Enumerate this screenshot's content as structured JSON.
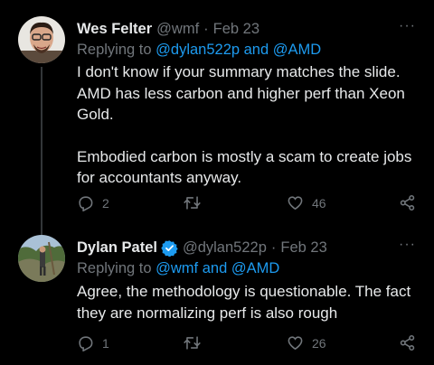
{
  "tweets": [
    {
      "name": "Wes Felter",
      "handle": "@wmf",
      "separator": "·",
      "date": "Feb 23",
      "replying_prefix": "Replying to ",
      "replying_mentions": "@dylan522p and @AMD",
      "paragraphs": [
        "I don't know if your summary matches the slide. AMD has less carbon and higher perf than Xeon Gold.",
        "Embodied carbon is mostly a scam to create jobs for accountants anyway."
      ],
      "replies": "2",
      "retweets": "",
      "likes": "46",
      "verified": false
    },
    {
      "name": "Dylan Patel",
      "handle": "@dylan522p",
      "separator": "·",
      "date": "Feb 23",
      "replying_prefix": "Replying to ",
      "replying_mentions": "@wmf and @AMD",
      "paragraphs": [
        "Agree, the methodology is questionable. The fact they are normalizing perf is also rough"
      ],
      "replies": "1",
      "retweets": "",
      "likes": "26",
      "verified": true
    }
  ],
  "more_label": "···",
  "colors": {
    "background": "#000000",
    "text": "#e7e9ea",
    "secondary": "#71767b",
    "accent": "#1d9bf0"
  },
  "icons": [
    "reply-icon",
    "retweet-icon",
    "like-icon",
    "share-icon",
    "more-icon",
    "verified-badge-icon"
  ]
}
